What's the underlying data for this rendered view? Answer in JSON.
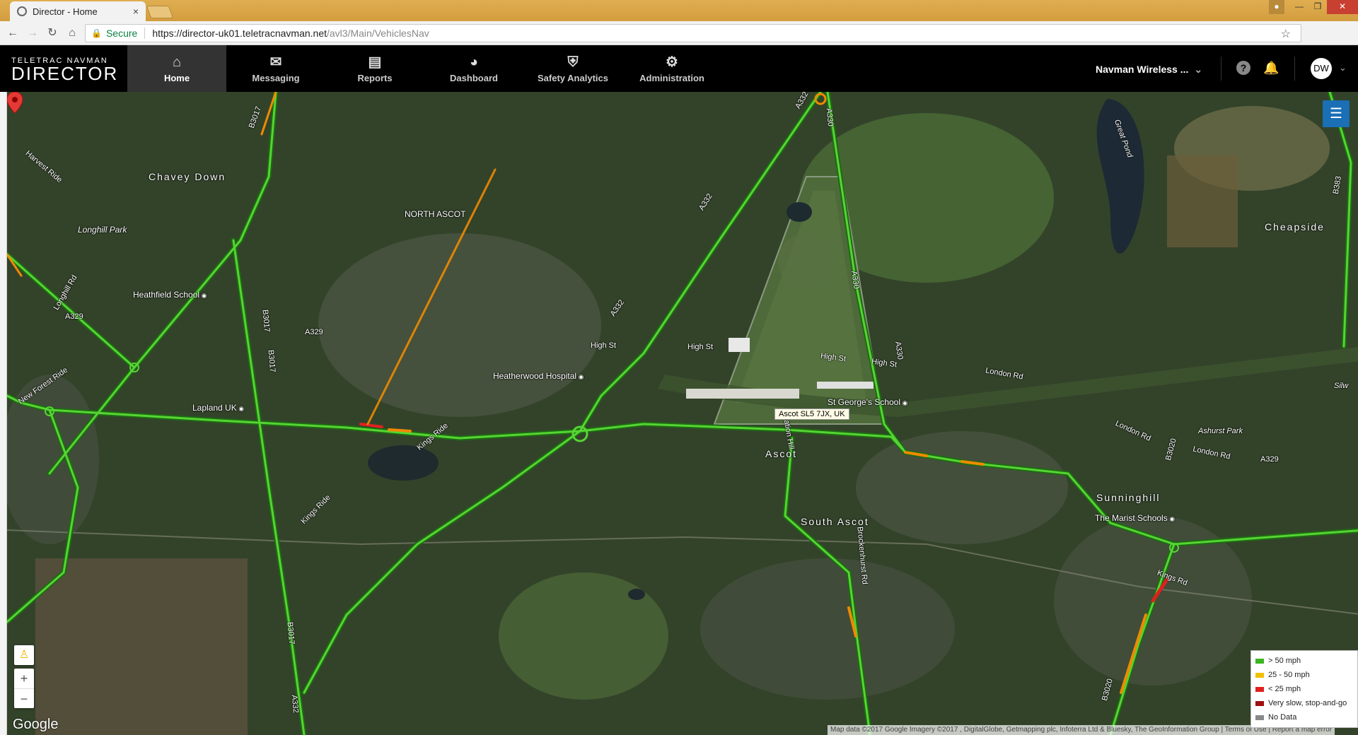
{
  "browser": {
    "tab_title": "Director - Home",
    "tab_close": "×",
    "secure_label": "Secure",
    "url_host": "https://director-uk01.teletracnavman.net",
    "url_path": "/avl3/Main/VehiclesNav"
  },
  "header": {
    "logo_line1": "TELETRAC NAVMAN",
    "logo_line2": "DIRECTOR",
    "nav": [
      {
        "label": "Home",
        "icon": "home-icon"
      },
      {
        "label": "Messaging",
        "icon": "envelope-icon"
      },
      {
        "label": "Reports",
        "icon": "reports-icon"
      },
      {
        "label": "Dashboard",
        "icon": "pie-chart-icon"
      },
      {
        "label": "Safety Analytics",
        "icon": "shield-icon"
      },
      {
        "label": "Administration",
        "icon": "gears-icon"
      }
    ],
    "account_name": "Navman Wireless ...",
    "avatar_initials": "DW"
  },
  "map": {
    "labels": {
      "chavey_down": "Chavey Down",
      "north_ascot": "NORTH ASCOT",
      "longhill_park": "Longhill Park",
      "heathfield_school": "Heathfield School",
      "heatherwood_hospital": "Heatherwood Hospital",
      "lapland_uk": "Lapland UK",
      "st_georges_school": "St George's School",
      "ascot": "Ascot",
      "south_ascot": "South Ascot",
      "sunninghill": "Sunninghill",
      "marist_schools": "The Marist Schools",
      "cheapside": "Cheapside",
      "great_pond": "Great Pond",
      "ashurst_park": "Ashurst Park",
      "silw": "Silw",
      "harvest_ride": "Harvest Ride",
      "new_forest_ride": "New Forest Ride",
      "longhill_rd": "Longhill Rd",
      "kings_ride_1": "Kings Ride",
      "kings_ride_2": "Kings Ride",
      "kings_rd": "Kings Rd",
      "high_st_1": "High St",
      "high_st_2": "High St",
      "high_st_3": "High St",
      "high_st_4": "High St",
      "london_rd_1": "London Rd",
      "london_rd_2": "London Rd",
      "london_rd_3": "London Rd",
      "station_hill": "Station Hill",
      "brockenhurst_rd": "Brockenhurst Rd",
      "a329_1": "A329",
      "a329_2": "A329",
      "a329_3": "A329",
      "a332_1": "A332",
      "a332_2": "A332",
      "a332_3": "A332",
      "a332_4": "A332",
      "a330_1": "A330",
      "a330_2": "A330",
      "a330_3": "A330",
      "b3017_1": "B3017",
      "b3017_2": "B3017",
      "b3017_3": "B3017",
      "b3017_4": "B3017",
      "b3020_1": "B3020",
      "b3020_2": "B3020",
      "b383": "B383"
    },
    "marker_label": "Ascot SL5 7JX, UK",
    "google": "Google",
    "attribution": "Map data ©2017 Google Imagery ©2017 , DigitalGlobe, Getmapping plc, Infoterra Ltd & Bluesky, The GeoInformation Group | Terms of Use | Report a map error",
    "legend": [
      {
        "label": "> 50 mph",
        "color": "#3cb521"
      },
      {
        "label": "25 - 50 mph",
        "color": "#f0c000"
      },
      {
        "label": "< 25 mph",
        "color": "#e02020"
      },
      {
        "label": "Very slow, stop-and-go",
        "color": "#a01010"
      },
      {
        "label": "No Data",
        "color": "#888888"
      }
    ],
    "controls": {
      "zoom_in": "+",
      "zoom_out": "−"
    }
  }
}
